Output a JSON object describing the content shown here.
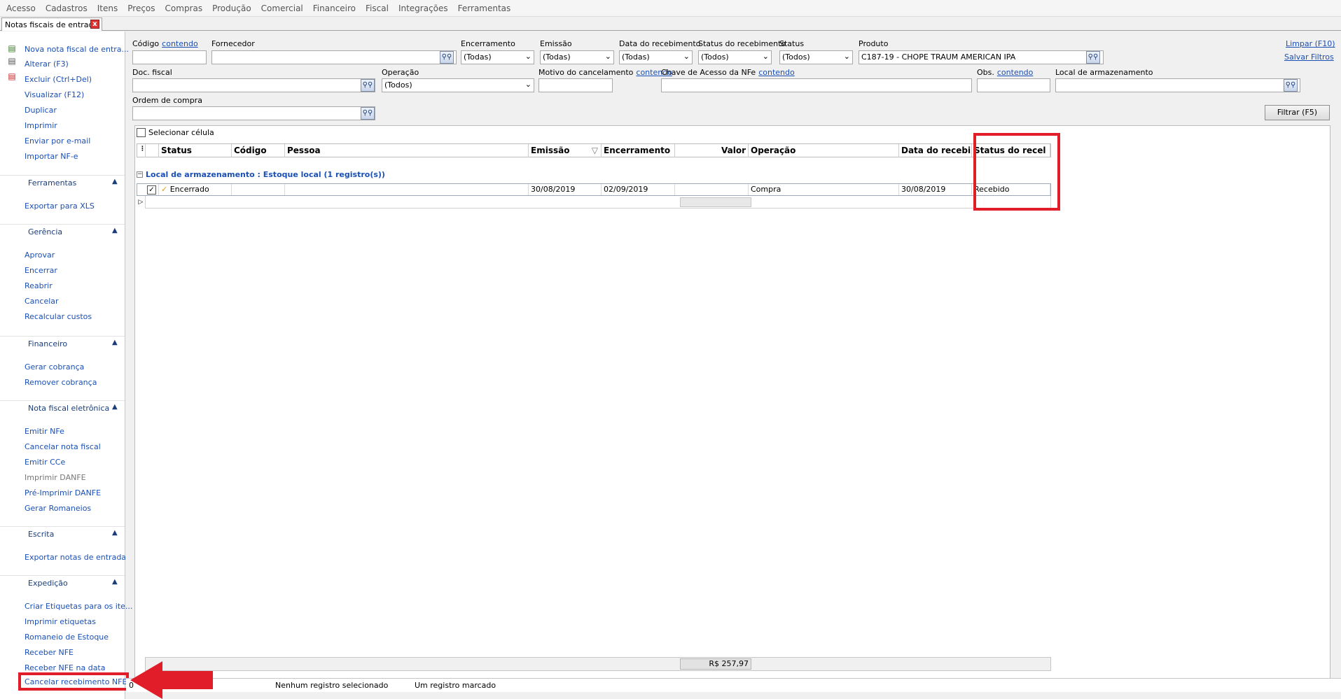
{
  "menu": [
    "Acesso",
    "Cadastros",
    "Itens",
    "Preços",
    "Compras",
    "Produção",
    "Comercial",
    "Financeiro",
    "Fiscal",
    "Integrações",
    "Ferramentas"
  ],
  "tab": {
    "title": "Notas fiscais de entrada",
    "close": "x"
  },
  "sidebar": {
    "actions": [
      "Nova nota fiscal de entra...",
      "Alterar (F3)",
      "Excluir (Ctrl+Del)",
      "Visualizar (F12)",
      "Duplicar",
      "Imprimir",
      "Enviar por e-mail",
      "Importar NF-e"
    ],
    "ferramentas": {
      "title": "Ferramentas",
      "items": [
        "Exportar para XLS"
      ]
    },
    "gerencia": {
      "title": "Gerência",
      "items": [
        "Aprovar",
        "Encerrar",
        "Reabrir",
        "Cancelar",
        "Recalcular custos"
      ]
    },
    "financeiro": {
      "title": "Financeiro",
      "items": [
        "Gerar cobrança",
        "Remover cobrança"
      ]
    },
    "nfe": {
      "title": "Nota fiscal eletrônica",
      "items": [
        "Emitir NFe",
        "Cancelar nota fiscal",
        "Emitir CCe",
        "Imprimir DANFE",
        "Pré-Imprimir DANFE",
        "Gerar Romaneios"
      ]
    },
    "escrita": {
      "title": "Escrita",
      "items": [
        "Exportar notas de entrada"
      ]
    },
    "expedicao": {
      "title": "Expedição",
      "items": [
        "Criar Etiquetas para os ite...",
        "Imprimir etiquetas",
        "Romaneio de Estoque",
        "Receber NFE",
        "Receber NFE na data",
        "Cancelar recebimento NFE"
      ]
    }
  },
  "filters": {
    "codigo_label": "Código",
    "contendo": "contendo",
    "fornecedor_label": "Fornecedor",
    "encerramento_label": "Encerramento",
    "encerramento_value": "(Todas)",
    "emissao_label": "Emissão",
    "emissao_value": "(Todas)",
    "data_receb_label": "Data do recebimento",
    "data_receb_value": "(Todas)",
    "status_receb_label": "Status do recebimento",
    "status_receb_value": "(Todos)",
    "status_label": "Status",
    "status_value": "(Todos)",
    "produto_label": "Produto",
    "produto_value": "C187-19 - CHOPE TRAUM AMERICAN IPA",
    "limpar": "Limpar (F10)",
    "salvar": "Salvar Filtros",
    "doc_label": "Doc. fiscal",
    "operacao_label": "Operação",
    "operacao_value": "(Todos)",
    "motivo_label": "Motivo do cancelamento",
    "chave_label": "Chave de Acesso da NFe",
    "obs_label": "Obs.",
    "local_label": "Local de armazenamento",
    "ordem_label": "Ordem de compra",
    "filtrar": "Filtrar (F5)"
  },
  "grid": {
    "select_cell": "Selecionar célula",
    "columns": [
      "Status",
      "Código",
      "Pessoa",
      "Emissão",
      "Encerramento",
      "Valor",
      "Operação",
      "Data do recebi",
      "Status do recel"
    ],
    "group": "Local de armazenamento : Estoque local (1 registro(s))",
    "row": {
      "status": "Encerrado",
      "codigo": "",
      "pessoa": "",
      "emissao": "30/08/2019",
      "encerramento": "02/09/2019",
      "valor": "",
      "operacao": "Compra",
      "data_receb": "30/08/2019",
      "status_receb": "Recebido"
    },
    "total": "R$ 257,97"
  },
  "statusbar": {
    "left": "0",
    "middle": "Nenhum registro selecionado",
    "right": "Um registro marcado"
  },
  "colors": {
    "highlight": "#e21d2a",
    "link": "#1a4fb5"
  }
}
